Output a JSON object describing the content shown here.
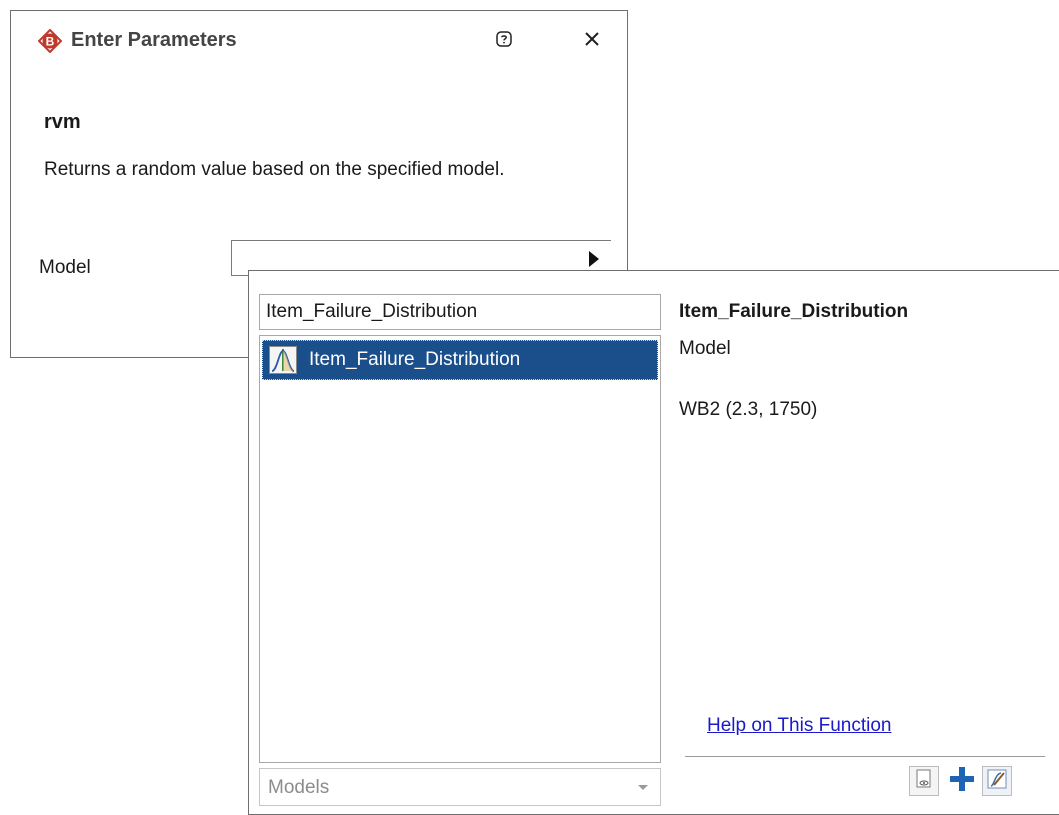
{
  "dialog": {
    "title": "Enter Parameters",
    "logo_letter": "B",
    "function_name": "rvm",
    "function_description": "Returns a random value based on the specified model.",
    "parameter_label": "Model",
    "model_value": "",
    "icons": {
      "logo": "b-logo-icon",
      "help": "help-icon",
      "close": "close-icon",
      "dropdown": "triangle-right-icon"
    }
  },
  "picker": {
    "search_value": "Item_Failure_Distribution",
    "items": [
      {
        "label": "Item_Failure_Distribution",
        "selected": true,
        "icon": "distribution-curve-icon"
      }
    ],
    "category": "Models",
    "detail": {
      "name": "Item_Failure_Distribution",
      "type": "Model",
      "value": "WB2 (2.3, 1750)"
    },
    "help_link": "Help on This Function",
    "toolbar_icons": [
      "view-icon",
      "add-icon",
      "edit-icon"
    ]
  },
  "colors": {
    "selection": "#1b4f8c",
    "link": "#1a1acc",
    "logo_red": "#c0392b"
  }
}
